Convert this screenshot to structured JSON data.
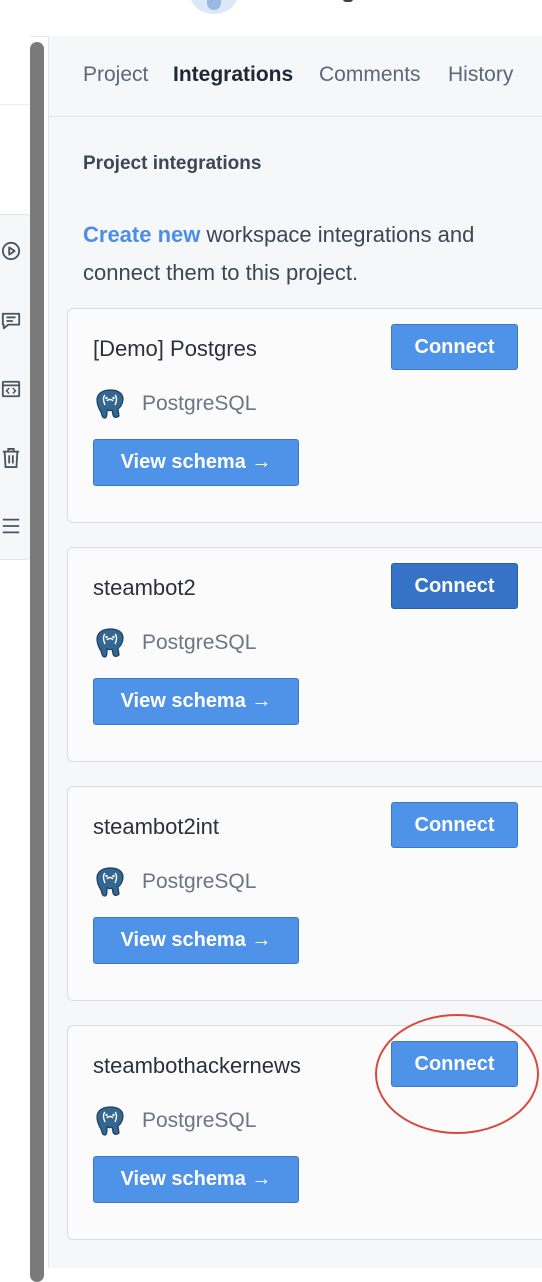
{
  "tabs": [
    {
      "label": "Project"
    },
    {
      "label": "Integrations"
    },
    {
      "label": "Comments"
    },
    {
      "label": "History"
    }
  ],
  "section_title": "Project integrations",
  "intro": {
    "link_text": "Create new",
    "text": " workspace integrations and connect them to this project."
  },
  "integrations": [
    {
      "name": "[Demo] Postgres",
      "type": "PostgreSQL",
      "connect_label": "Connect",
      "schema_label": "View schema →"
    },
    {
      "name": "steambot2",
      "type": "PostgreSQL",
      "connect_label": "Connect",
      "schema_label": "View schema →"
    },
    {
      "name": "steambot2int",
      "type": "PostgreSQL",
      "connect_label": "Connect",
      "schema_label": "View schema →"
    },
    {
      "name": "steambothackernews",
      "type": "PostgreSQL",
      "connect_label": "Connect",
      "schema_label": "View schema →"
    }
  ],
  "toolbar_icons": [
    "play-circle-icon",
    "comment-icon",
    "code-window-icon",
    "trash-icon",
    "list-icon"
  ],
  "colors": {
    "accent": "#4f93e8",
    "accent_hover": "#3672c6",
    "annotation": "#d9483b"
  }
}
